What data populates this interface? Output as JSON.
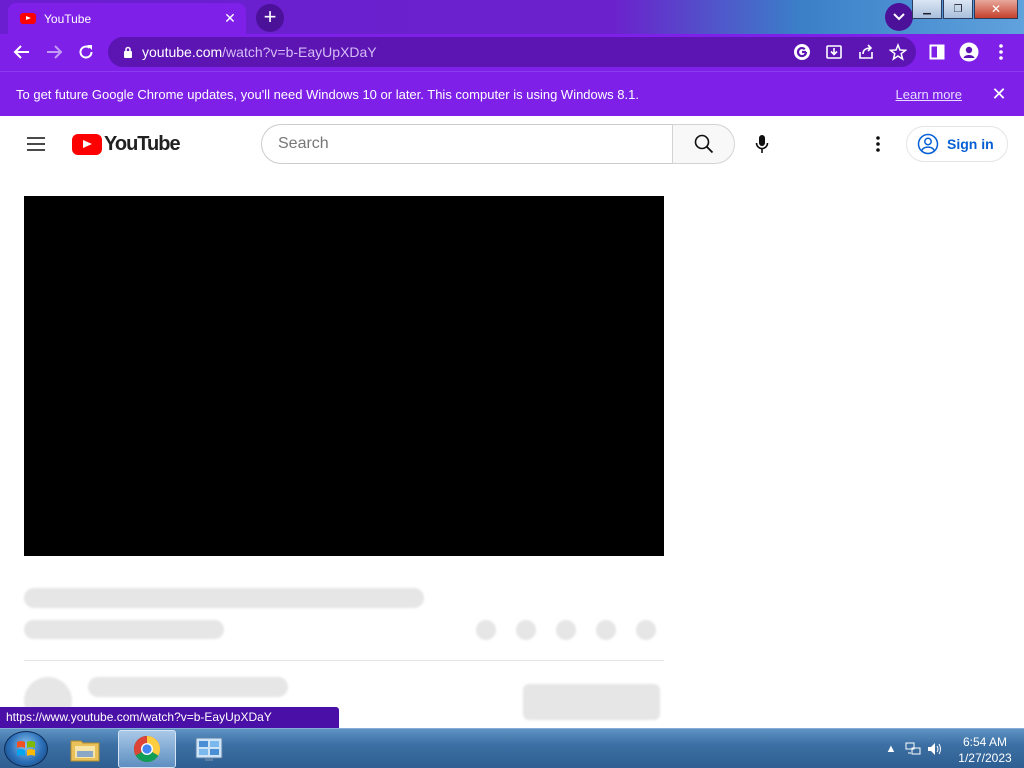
{
  "browser": {
    "tab": {
      "title": "YouTube"
    },
    "address": {
      "host": "youtube.com",
      "path": "/watch?v=b-EayUpXDaY"
    },
    "infobar": {
      "message": "To get future Google Chrome updates, you'll need Windows 10 or later. This computer is using Windows 8.1.",
      "link": "Learn more"
    },
    "status_url": "https://www.youtube.com/watch?v=b-EayUpXDaY",
    "accent": "#7e20e8"
  },
  "youtube": {
    "logo_text": "YouTube",
    "search": {
      "placeholder": "Search"
    },
    "signin_label": "Sign in",
    "brand_color": "#ff0000",
    "link_color": "#065fd4"
  },
  "taskbar": {
    "apps": [
      "file-explorer",
      "google-chrome",
      "control-panel"
    ],
    "clock": {
      "time": "6:54 AM",
      "date": "1/27/2023"
    }
  }
}
